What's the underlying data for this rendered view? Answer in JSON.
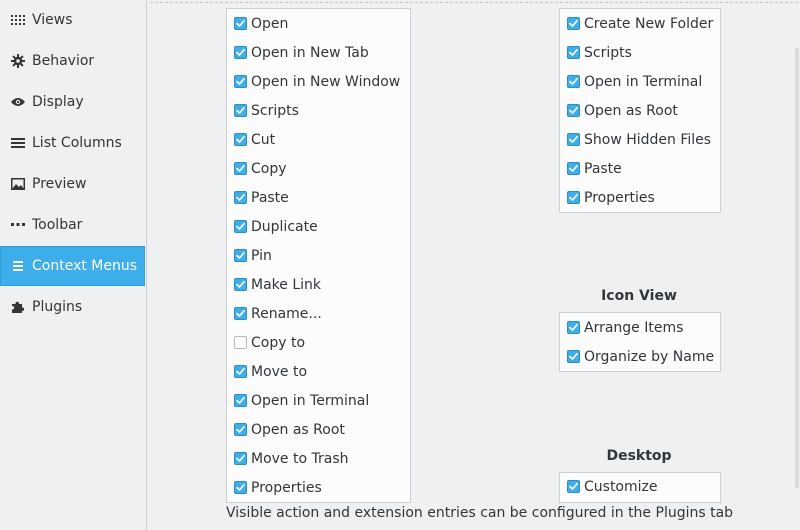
{
  "sidebar": {
    "items": [
      {
        "label": "Views",
        "icon": "grid-dots-icon",
        "active": false
      },
      {
        "label": "Behavior",
        "icon": "gear-icon",
        "active": false
      },
      {
        "label": "Display",
        "icon": "eye-icon",
        "active": false
      },
      {
        "label": "List Columns",
        "icon": "list-icon",
        "active": false
      },
      {
        "label": "Preview",
        "icon": "image-icon",
        "active": false
      },
      {
        "label": "Toolbar",
        "icon": "toolbar-dots-icon",
        "active": false
      },
      {
        "label": "Context Menus",
        "icon": "menu-icon",
        "active": true
      },
      {
        "label": "Plugins",
        "icon": "puzzle-icon",
        "active": false
      }
    ]
  },
  "file_menu": {
    "items": [
      {
        "label": "Open",
        "checked": true
      },
      {
        "label": "Open in New Tab",
        "checked": true
      },
      {
        "label": "Open in New Window",
        "checked": true
      },
      {
        "label": "Scripts",
        "checked": true
      },
      {
        "label": "Cut",
        "checked": true
      },
      {
        "label": "Copy",
        "checked": true
      },
      {
        "label": "Paste",
        "checked": true
      },
      {
        "label": "Duplicate",
        "checked": true
      },
      {
        "label": "Pin",
        "checked": true
      },
      {
        "label": "Make Link",
        "checked": true
      },
      {
        "label": "Rename...",
        "checked": true
      },
      {
        "label": "Copy to",
        "checked": false
      },
      {
        "label": "Move to",
        "checked": true
      },
      {
        "label": "Open in Terminal",
        "checked": true
      },
      {
        "label": "Open as Root",
        "checked": true
      },
      {
        "label": "Move to Trash",
        "checked": true
      },
      {
        "label": "Properties",
        "checked": true
      }
    ]
  },
  "folder_menu": {
    "items": [
      {
        "label": "Create New Folder",
        "checked": true
      },
      {
        "label": "Scripts",
        "checked": true
      },
      {
        "label": "Open in Terminal",
        "checked": true
      },
      {
        "label": "Open as Root",
        "checked": true
      },
      {
        "label": "Show Hidden Files",
        "checked": true
      },
      {
        "label": "Paste",
        "checked": true
      },
      {
        "label": "Properties",
        "checked": true
      }
    ]
  },
  "icon_view": {
    "title": "Icon View",
    "items": [
      {
        "label": "Arrange Items",
        "checked": true
      },
      {
        "label": "Organize by Name",
        "checked": true
      }
    ]
  },
  "desktop": {
    "title": "Desktop",
    "items": [
      {
        "label": "Customize",
        "checked": true
      }
    ]
  },
  "footer_text": "Visible action and extension entries can be configured in the Plugins tab",
  "colors": {
    "accent": "#3daee9",
    "background": "#eff0f1",
    "panel": "#fcfcfc",
    "text": "#31363b"
  }
}
